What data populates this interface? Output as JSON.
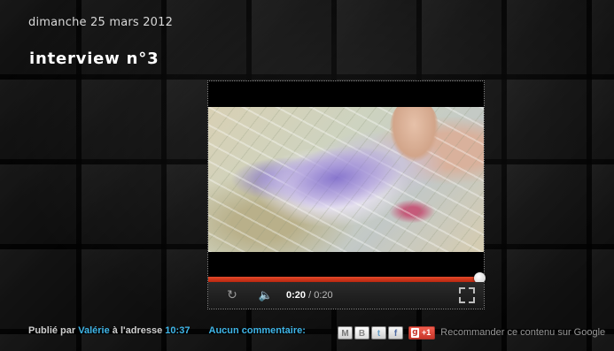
{
  "post": {
    "date": "dimanche 25 mars 2012",
    "title": "interview n°3"
  },
  "player": {
    "current_time": "0:20",
    "separator": " / ",
    "total_time": "0:20",
    "progress": 1.0,
    "icons": {
      "replay": "replay-icon",
      "volume": "volume-icon",
      "fullscreen": "fullscreen-icon"
    }
  },
  "footer": {
    "published_by": "Publié par",
    "author": "Valérie",
    "at_address": "à l'adresse",
    "time": "10:37",
    "comments": "Aucun commentaire:",
    "share": {
      "email_label": "M",
      "blog_label": "B",
      "twitter_label": "t",
      "facebook_label": "f",
      "plusone_label": "+1",
      "recommend_text": "Recommander ce contenu sur Google"
    }
  },
  "colors": {
    "link": "#3fb6e9",
    "progress": "#d2381c",
    "background": "#1b1b1b"
  }
}
